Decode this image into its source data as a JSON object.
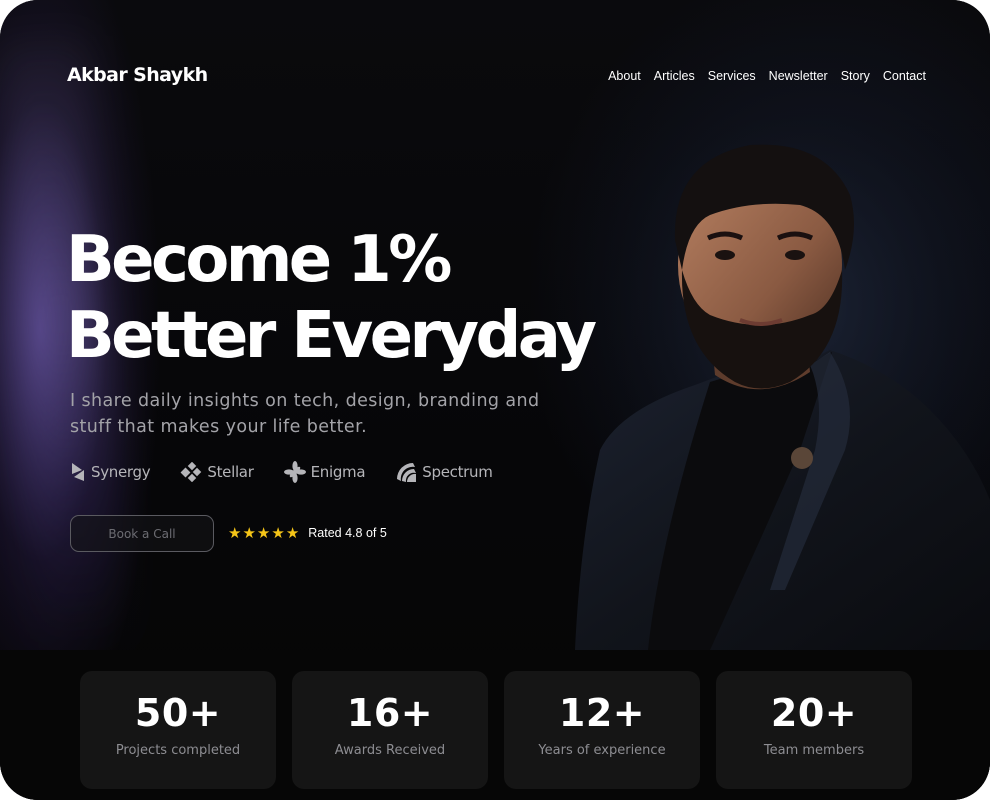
{
  "header": {
    "logo": "Akbar Shaykh",
    "nav": [
      "About",
      "Articles",
      "Services",
      "Newsletter",
      "Story",
      "Contact"
    ]
  },
  "hero": {
    "headline_line1": "Become 1%",
    "headline_line2": "Better Everyday",
    "subtitle": "I share daily insights on tech, design, branding and stuff that makes your life better.",
    "brands": [
      {
        "name": "Synergy",
        "icon": "synergy-logo-icon"
      },
      {
        "name": "Stellar",
        "icon": "stellar-logo-icon"
      },
      {
        "name": "Enigma",
        "icon": "enigma-logo-icon"
      },
      {
        "name": "Spectrum",
        "icon": "spectrum-logo-icon"
      }
    ],
    "cta_label": "Book a Call",
    "rating": {
      "stars": 5,
      "text": "Rated 4.8 of 5",
      "star_color": "#f5c518"
    }
  },
  "stats": [
    {
      "value": "50+",
      "label": "Projects completed"
    },
    {
      "value": "16+",
      "label": "Awards Received"
    },
    {
      "value": "12+",
      "label": "Years of experience"
    },
    {
      "value": "20+",
      "label": "Team members"
    }
  ],
  "colors": {
    "background": "#050507",
    "card": "#151515",
    "accent_glow": "#785fc8"
  }
}
